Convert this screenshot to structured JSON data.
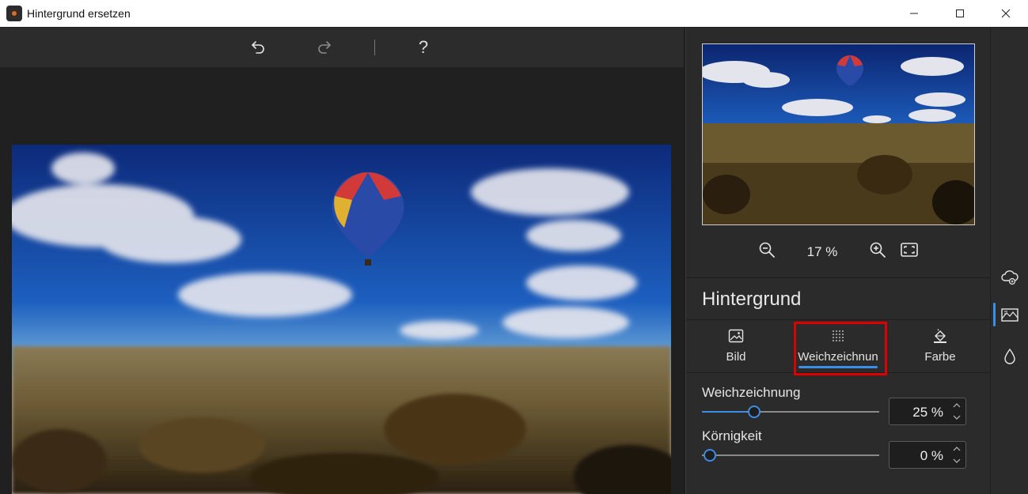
{
  "window": {
    "title": "Hintergrund ersetzen",
    "minimize_symbol": "—",
    "maximize_symbol": "☐",
    "close_symbol": "✕"
  },
  "toolbar": {
    "undo_icon": "undo-icon",
    "redo_icon": "redo-icon",
    "help_label": "?"
  },
  "preview": {
    "zoom_level": "17 %"
  },
  "panel": {
    "section_title": "Hintergrund",
    "tabs": [
      {
        "label": "Bild",
        "icon": "image-icon"
      },
      {
        "label": "Weichzeichnun",
        "icon": "blur-icon",
        "active": true
      },
      {
        "label": "Farbe",
        "icon": "paint-bucket-icon"
      }
    ],
    "sliders": [
      {
        "label": "Weichzeichnung",
        "value_text": "25 %",
        "value": 25
      },
      {
        "label": "Körnigkeit",
        "value_text": "0 %",
        "value": 0
      }
    ]
  },
  "rail": {
    "items": [
      "cloud-replace-icon",
      "background-icon",
      "drop-icon"
    ],
    "active_index": 1
  },
  "colors": {
    "accent": "#3a8ee6",
    "highlight": "#e00000",
    "panel_bg": "#2b2b2b"
  }
}
